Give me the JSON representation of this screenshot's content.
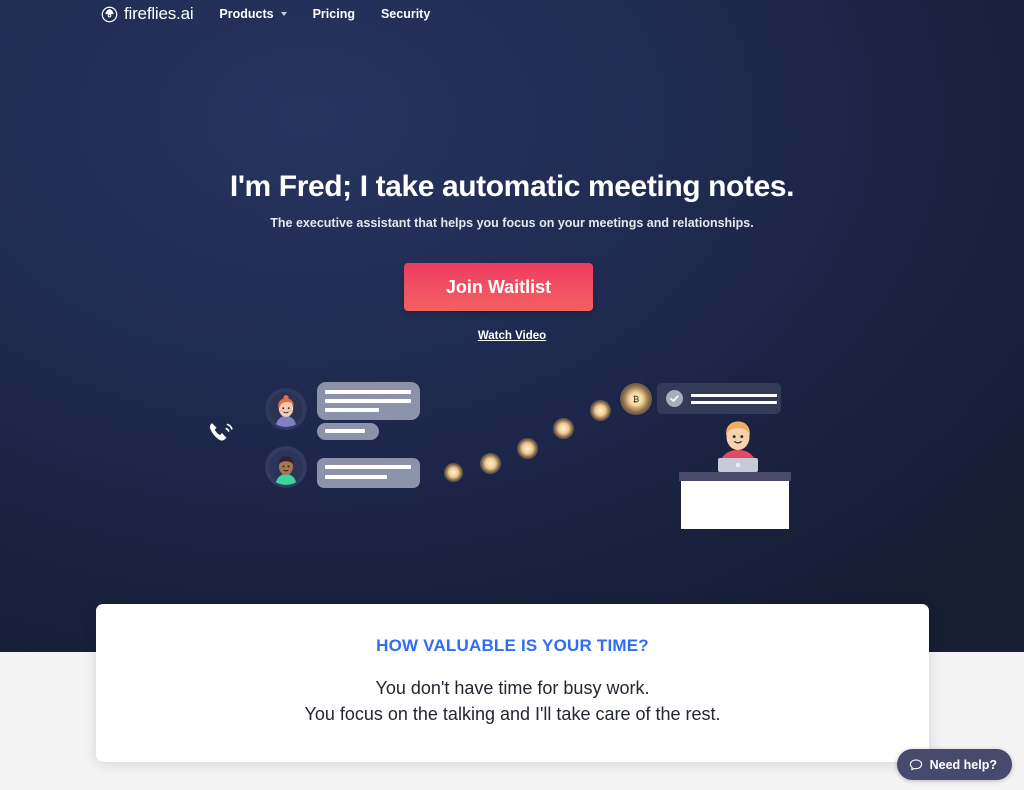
{
  "nav": {
    "brand": {
      "name": "fireflies.ai",
      "icon": "fireflies-logo-icon"
    },
    "links": [
      {
        "label": "Products",
        "has_dropdown": true,
        "icon": "chevron-down-icon"
      },
      {
        "label": "Pricing",
        "has_dropdown": false
      },
      {
        "label": "Security",
        "has_dropdown": false
      }
    ]
  },
  "hero": {
    "title": "I'm Fred; I take automatic meeting notes.",
    "subtitle": "The executive assistant that helps you focus on your meetings and relationships.",
    "cta_label": "Join Waitlist",
    "watch_video_label": "Watch Video",
    "background_color": "#1e2848",
    "cta_color": "#f1485f"
  },
  "illustration": {
    "phone_icon": "phone-ringing-icon",
    "participants": [
      {
        "name": "participant-avatar-1",
        "hair": "#e0703f",
        "skin": "#f3cdb4",
        "shirt": "#7d81c4"
      },
      {
        "name": "participant-avatar-2",
        "hair": "#2b2332",
        "skin": "#a87551",
        "shirt": "#3ed49b"
      }
    ],
    "notification": {
      "icon": "check-circle-icon",
      "lines": 2
    },
    "worker": {
      "name": "person-at-desk",
      "hair": "#f0ae5e",
      "skin": "#f6d3ae",
      "shirt": "#e24a5f"
    },
    "particles": 6,
    "coin_label": "₿"
  },
  "card": {
    "heading": "HOW VALUABLE IS YOUR TIME?",
    "line1": "You don't have time for busy work.",
    "line2": "You focus on the talking and I'll take care of the rest.",
    "heading_color": "#2f6df4"
  },
  "chat_widget": {
    "label": "Need help?",
    "icon": "chat-bubble-icon",
    "background_color": "#484a6d"
  }
}
